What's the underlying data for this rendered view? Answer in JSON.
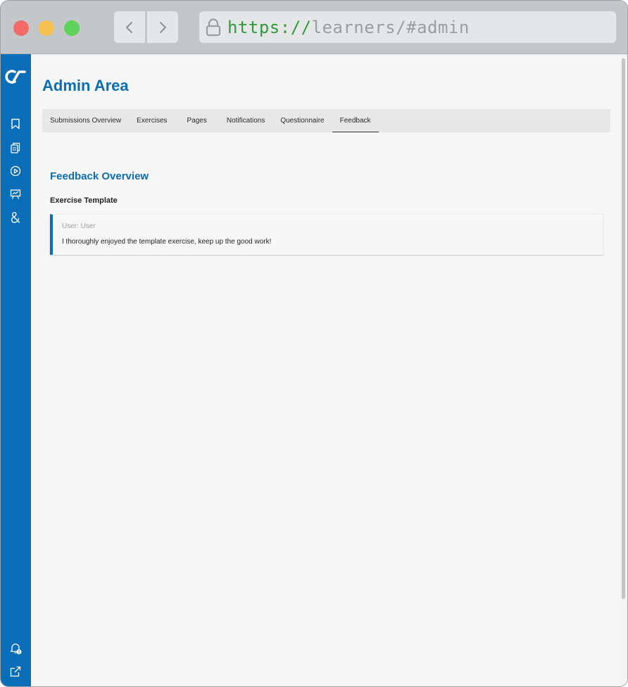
{
  "browser": {
    "url_scheme": "https://",
    "url_rest": "learners/#admin"
  },
  "sidebar": {
    "icons": [
      "logo-icon",
      "bookmark-icon",
      "documents-icon",
      "play-icon",
      "presentation-chart-icon",
      "ampersand-icon",
      "bell-help-icon",
      "external-link-icon"
    ],
    "color": "#0a6db7"
  },
  "page": {
    "title": "Admin Area"
  },
  "tabs": [
    {
      "label": "Submissions Overview",
      "active": false
    },
    {
      "label": "Exercises",
      "active": false
    },
    {
      "label": "Pages",
      "active": false
    },
    {
      "label": "Notifications",
      "active": false
    },
    {
      "label": "Questionnaire",
      "active": false
    },
    {
      "label": "Feedback",
      "active": true
    }
  ],
  "feedback": {
    "section_title": "Feedback Overview",
    "group_title": "Exercise Template",
    "entries": [
      {
        "user": "User: User",
        "text": "I thoroughly enjoyed the template exercise, keep up the good work!"
      }
    ]
  },
  "colors": {
    "accent": "#0a6db7",
    "url_green": "#2f9b3a"
  }
}
